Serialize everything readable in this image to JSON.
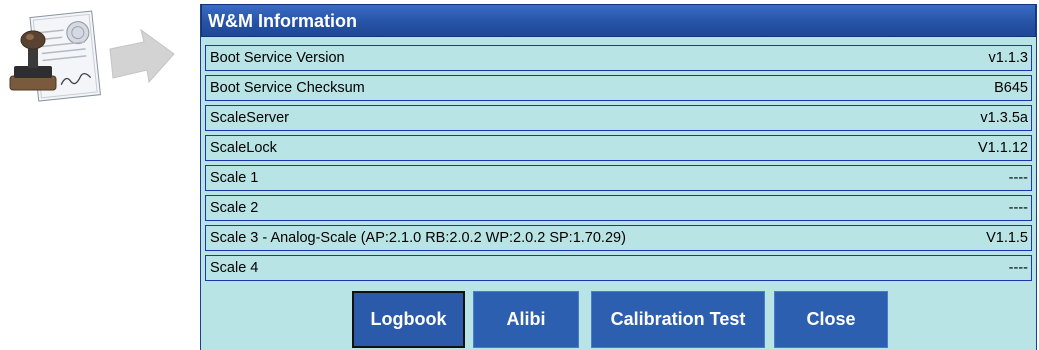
{
  "dialog": {
    "title": "W&M Information",
    "rows": [
      {
        "label": "Boot Service Version",
        "value": "v1.1.3"
      },
      {
        "label": "Boot Service Checksum",
        "value": "B645"
      },
      {
        "label": "ScaleServer",
        "value": "v1.3.5a"
      },
      {
        "label": "ScaleLock",
        "value": "V1.1.12"
      },
      {
        "label": "Scale 1",
        "value": "----"
      },
      {
        "label": "Scale 2",
        "value": "----"
      },
      {
        "label": "Scale 3 - Analog-Scale (AP:2.1.0 RB:2.0.2 WP:2.0.2 SP:1.70.29)",
        "value": "V1.1.5"
      },
      {
        "label": "Scale 4",
        "value": "----"
      }
    ],
    "buttons": {
      "logbook": "Logbook",
      "alibi": "Alibi",
      "calibration_test": "Calibration Test",
      "close": "Close"
    }
  },
  "colors": {
    "panel": "#b9e4e6",
    "titlebar": "#2653a6",
    "row_border": "#1f35b0",
    "button": "#2d5fb0"
  },
  "icons": {
    "illustration": "certificate-stamp-icon",
    "pointer": "arrow-right-icon"
  }
}
